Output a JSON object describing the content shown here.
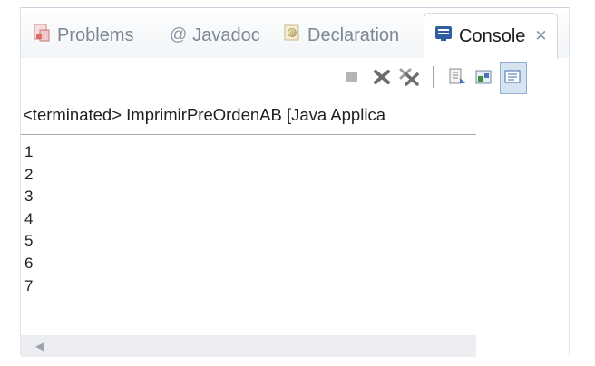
{
  "tabs": [
    {
      "label": "Problems",
      "icon": "problems-icon"
    },
    {
      "label": "Javadoc",
      "icon": "at-icon",
      "glyph": "@"
    },
    {
      "label": "Declaration",
      "icon": "declaration-icon"
    },
    {
      "label": "Console",
      "icon": "console-icon",
      "active": true,
      "close": "✕"
    }
  ],
  "console": {
    "header": "<terminated> ImprimirPreOrdenAB [Java Applica",
    "lines": [
      "1",
      "2",
      "3",
      "4",
      "5",
      "6",
      "7"
    ]
  },
  "toolbar": {
    "icons": [
      "terminate-icon",
      "remove-launch-icon",
      "remove-all-terminated-icon",
      "scroll-lock-icon",
      "pin-console-icon",
      "display-console-icon"
    ]
  },
  "colors": {
    "accent": "#2f5f9e",
    "terminate_red": "#c0392b"
  }
}
